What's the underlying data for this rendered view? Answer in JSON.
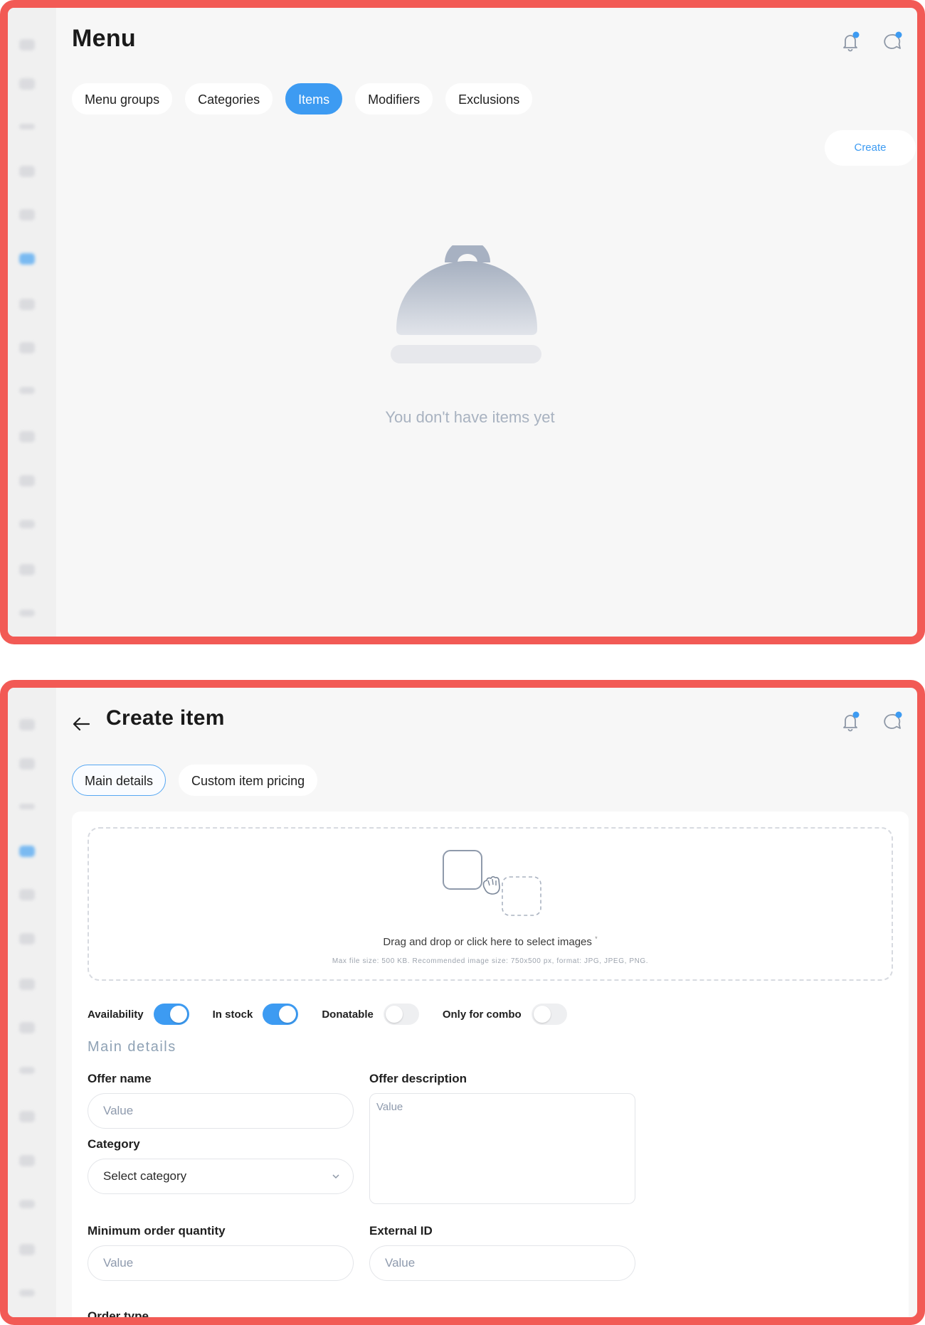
{
  "menu_page": {
    "title": "Menu",
    "tabs": [
      {
        "label": "Menu groups",
        "active": false
      },
      {
        "label": "Categories",
        "active": false
      },
      {
        "label": "Items",
        "active": true
      },
      {
        "label": "Modifiers",
        "active": false
      },
      {
        "label": "Exclusions",
        "active": false
      }
    ],
    "create_label": "Create",
    "empty_state_text": "You don't have items yet"
  },
  "create_page": {
    "title": "Create item",
    "tabs": [
      {
        "label": "Main details",
        "active": true
      },
      {
        "label": "Custom item pricing",
        "active": false
      }
    ],
    "dropzone": {
      "text": "Drag and drop or click here to select images",
      "required_mark": "*",
      "hint": "Max file size: 500 KB. Recommended image size: 750x500 px, format: JPG, JPEG, PNG."
    },
    "toggles": [
      {
        "label": "Availability",
        "on": true
      },
      {
        "label": "In stock",
        "on": true
      },
      {
        "label": "Donatable",
        "on": false
      },
      {
        "label": "Only for combo",
        "on": false
      }
    ],
    "section_title": "Main details",
    "fields": {
      "offer_name": {
        "label": "Offer name",
        "placeholder": "Value"
      },
      "offer_description": {
        "label": "Offer description",
        "placeholder": "Value"
      },
      "category": {
        "label": "Category",
        "value": "Select category"
      },
      "min_order_qty": {
        "label": "Minimum order quantity",
        "placeholder": "Value"
      },
      "external_id": {
        "label": "External ID",
        "placeholder": "Value"
      },
      "order_type": {
        "label": "Order type"
      }
    }
  },
  "icons": {
    "bell": "bell-icon",
    "chat": "chat-icon",
    "back": "back-arrow-icon",
    "cloche": "cloche-icon",
    "image_drop": "image-drop-icon",
    "chevron": "chevron-down-icon"
  },
  "colors": {
    "accent": "#3d9bf2",
    "frame": "#f25a55",
    "notification_dot": "#3d9bf2",
    "muted_text": "#a8b2c0"
  }
}
